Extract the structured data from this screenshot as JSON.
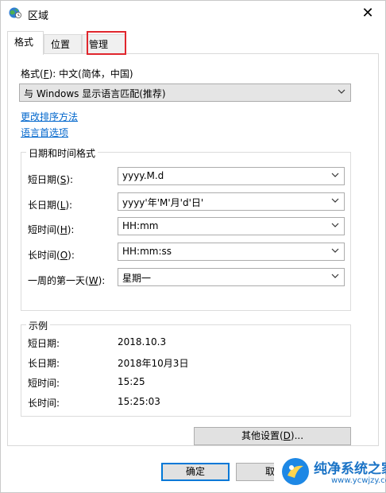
{
  "window": {
    "title": "区域",
    "close_glyph": "✕"
  },
  "tabs": [
    {
      "label": "格式",
      "active": true
    },
    {
      "label": "位置",
      "active": false
    },
    {
      "label": "管理",
      "active": false
    }
  ],
  "format": {
    "label_prefix": "格式(",
    "label_key": "F",
    "label_suffix": "): 中文(简体，中国)",
    "dropdown_value": "与 Windows 显示语言匹配(推荐)"
  },
  "links": {
    "sort": "更改排序方法",
    "language": "语言首选项"
  },
  "datetime": {
    "group_title": "日期和时间格式",
    "rows": [
      {
        "pre": "短日期(",
        "key": "S",
        "post": "):",
        "value": "yyyy.M.d"
      },
      {
        "pre": "长日期(",
        "key": "L",
        "post": "):",
        "value": "yyyy'年'M'月'd'日'"
      },
      {
        "pre": "短时间(",
        "key": "H",
        "post": "):",
        "value": "HH:mm"
      },
      {
        "pre": "长时间(",
        "key": "O",
        "post": "):",
        "value": "HH:mm:ss"
      },
      {
        "pre": "一周的第一天(",
        "key": "W",
        "post": "):",
        "value": "星期一"
      }
    ]
  },
  "examples": {
    "group_title": "示例",
    "rows": [
      {
        "label": "短日期:",
        "value": "2018.10.3"
      },
      {
        "label": "长日期:",
        "value": "2018年10月3日"
      },
      {
        "label": "短时间:",
        "value": "15:25"
      },
      {
        "label": "长时间:",
        "value": "15:25:03"
      }
    ]
  },
  "buttons": {
    "other_prefix": "其他设置(",
    "other_key": "D",
    "other_suffix": ")...",
    "ok": "确定",
    "cancel_partial": "取"
  },
  "watermark": {
    "text": "纯净系统之家",
    "sub": "www.ycwjzy.com"
  },
  "colors": {
    "accent": "#0078d7",
    "highlight": "#e0262d",
    "link": "#0066cc"
  }
}
